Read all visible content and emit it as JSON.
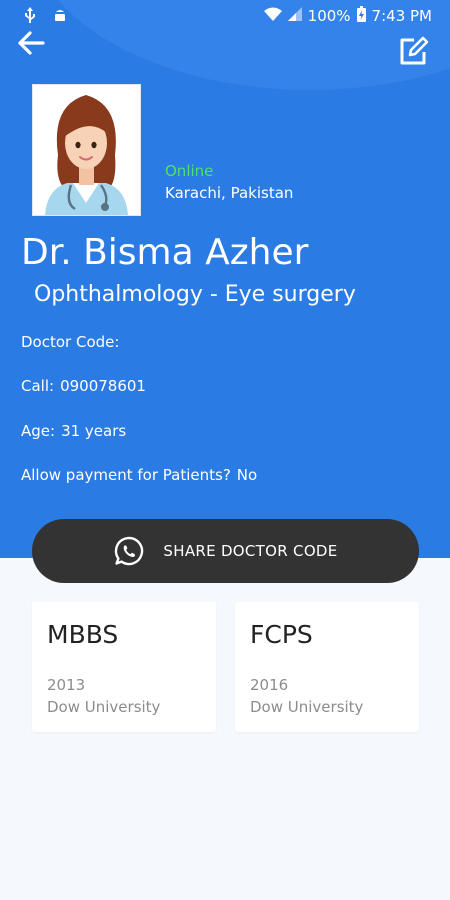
{
  "status_bar": {
    "battery": "100%",
    "time": "7:43 PM",
    "icons": [
      "usb-icon",
      "android-debug-icon",
      "wifi-icon",
      "signal-icon",
      "battery-icon"
    ]
  },
  "header": {
    "back_icon": "arrow-left-icon",
    "edit_icon": "edit-icon"
  },
  "profile": {
    "status": "Online",
    "location": "Karachi, Pakistan",
    "name": "Dr. Bisma Azher",
    "specialty": "Ophthalmology - Eye surgery"
  },
  "details": {
    "doctor_code_label": "Doctor Code:",
    "doctor_code_value": "",
    "call_label": "Call:",
    "call_value": "090078601",
    "age_label": "Age:",
    "age_value": "31 years",
    "payment_label": "Allow payment for Patients?",
    "payment_value": "No"
  },
  "share_button": {
    "label": "SHARE DOCTOR CODE",
    "icon": "whatsapp-icon"
  },
  "qualifications": [
    {
      "degree": "MBBS",
      "year": "2013",
      "university": "Dow University"
    },
    {
      "degree": "FCPS",
      "year": "2016",
      "university": "Dow University"
    }
  ],
  "colors": {
    "header_blue": "#2b7be4",
    "online_green": "#4be36b",
    "button_dark": "#333333",
    "background": "#f5f9fd"
  }
}
